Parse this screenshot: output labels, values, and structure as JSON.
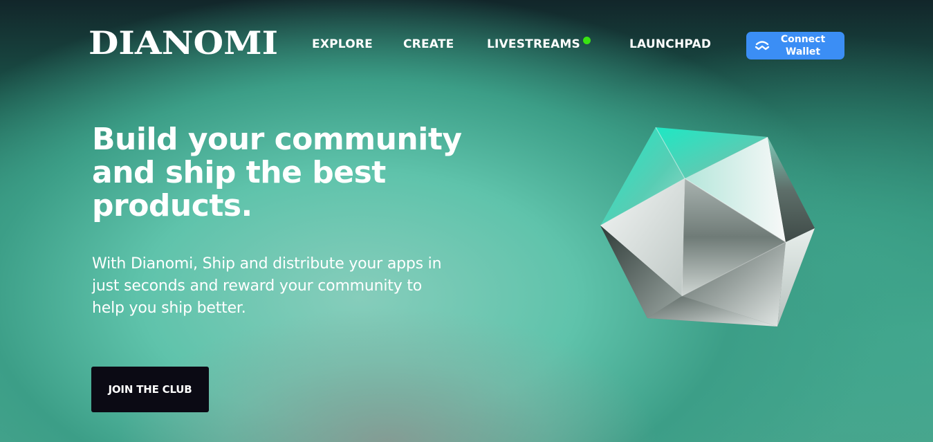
{
  "brand": {
    "logo_text": "DIANOMI"
  },
  "nav": {
    "items": [
      {
        "label": "EXPLORE"
      },
      {
        "label": "CREATE"
      },
      {
        "label": "LIVESTREAMS"
      },
      {
        "label": "LAUNCHPAD"
      }
    ],
    "live_indicator_color": "#39e312"
  },
  "connect": {
    "line1": "Connect",
    "line2": "Wallet",
    "icon": "walletconnect-icon",
    "color": "#3b8ef5"
  },
  "hero": {
    "title_line1": "Build your community",
    "title_line2": "and ship the best",
    "title_line3": "products.",
    "subtitle_line1": "With Dianomi, Ship and distribute your apps in",
    "subtitle_line2": "just seconds and reward your community to",
    "subtitle_line3": "help you ship better.",
    "cta_label": "JOIN THE CLUB",
    "illustration": "icosahedron-gem"
  },
  "colors": {
    "accent_teal": "#1de0bd",
    "cta_background": "#0b0a14"
  }
}
